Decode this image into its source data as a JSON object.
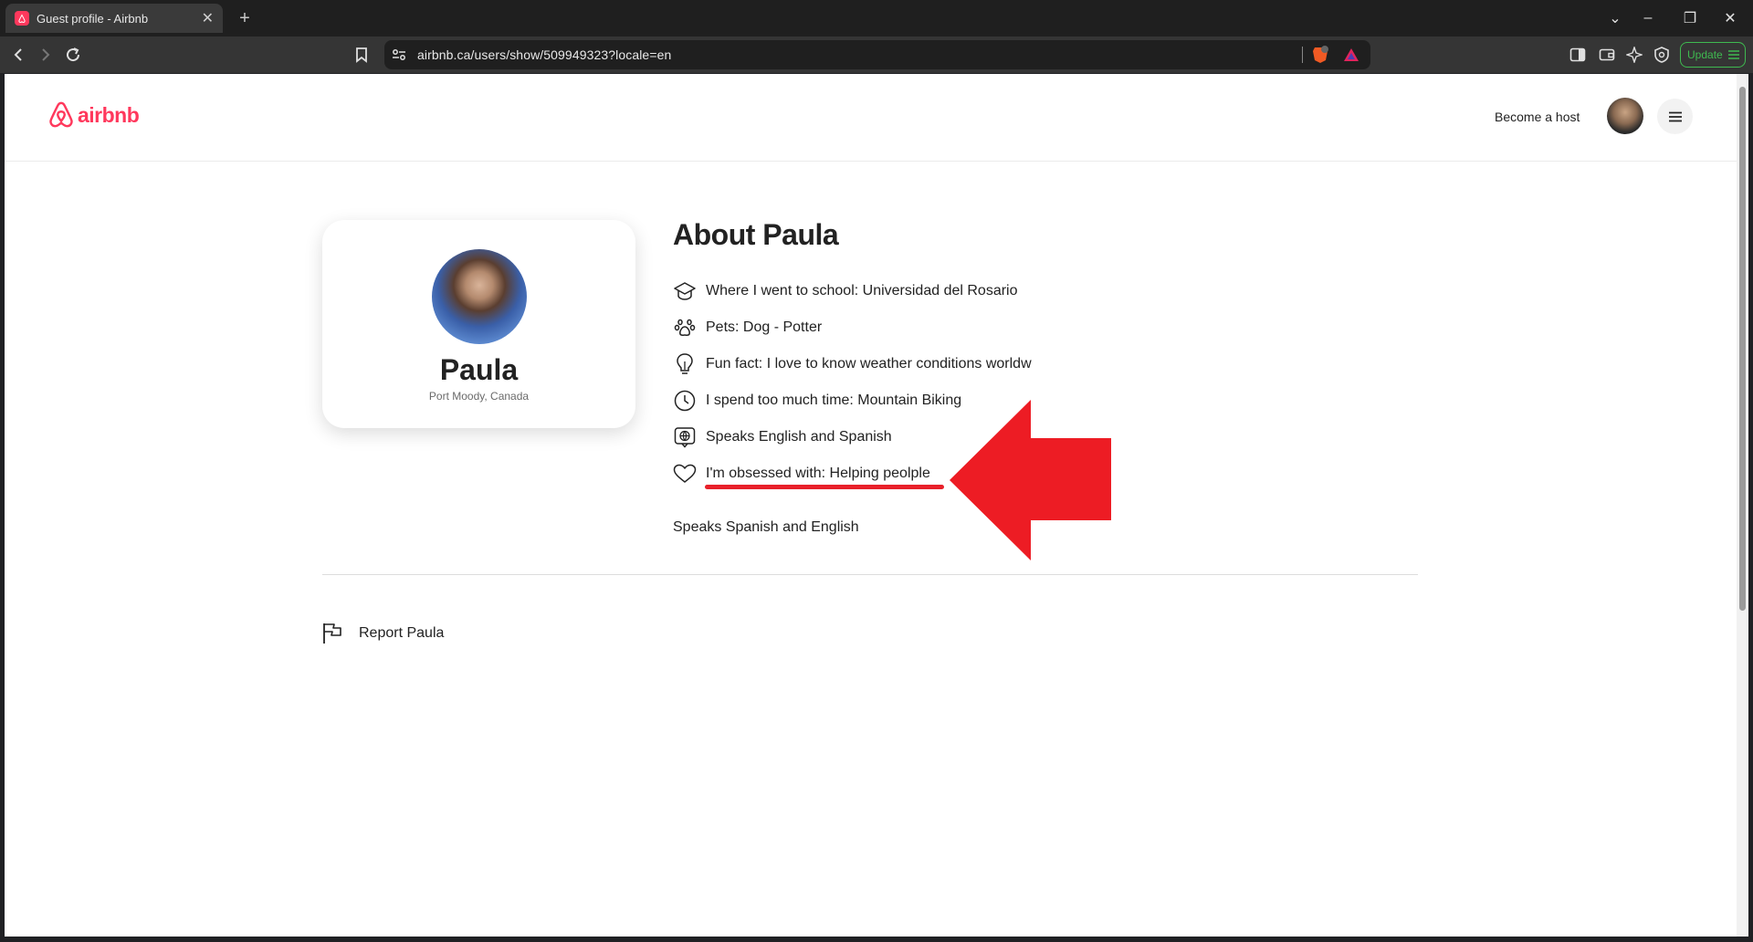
{
  "browser": {
    "tab_title": "Guest profile - Airbnb",
    "url": "airbnb.ca/users/show/509949323?locale=en",
    "update_label": "Update"
  },
  "header": {
    "logo_text": "airbnb",
    "become_host": "Become a host"
  },
  "profile": {
    "name": "Paula",
    "location": "Port Moody, Canada"
  },
  "about": {
    "title": "About Paula",
    "details": [
      {
        "icon": "graduation-cap-icon",
        "text": "Where I went to school: Universidad del Rosario"
      },
      {
        "icon": "paw-icon",
        "text": "Pets: Dog - Potter"
      },
      {
        "icon": "lightbulb-icon",
        "text": "Fun fact: I love to know weather conditions worldw"
      },
      {
        "icon": "clock-icon",
        "text": "I spend too much time: Mountain Biking"
      },
      {
        "icon": "language-icon",
        "text": "Speaks English and Spanish"
      },
      {
        "icon": "heart-icon",
        "text": "I'm obsessed with: Helping peolple"
      }
    ],
    "languages": "Speaks Spanish and English"
  },
  "report": {
    "label": "Report Paula"
  },
  "annotation": {
    "color": "#e8202a"
  },
  "colors": {
    "brand": "#ff385c",
    "text": "#222222"
  }
}
